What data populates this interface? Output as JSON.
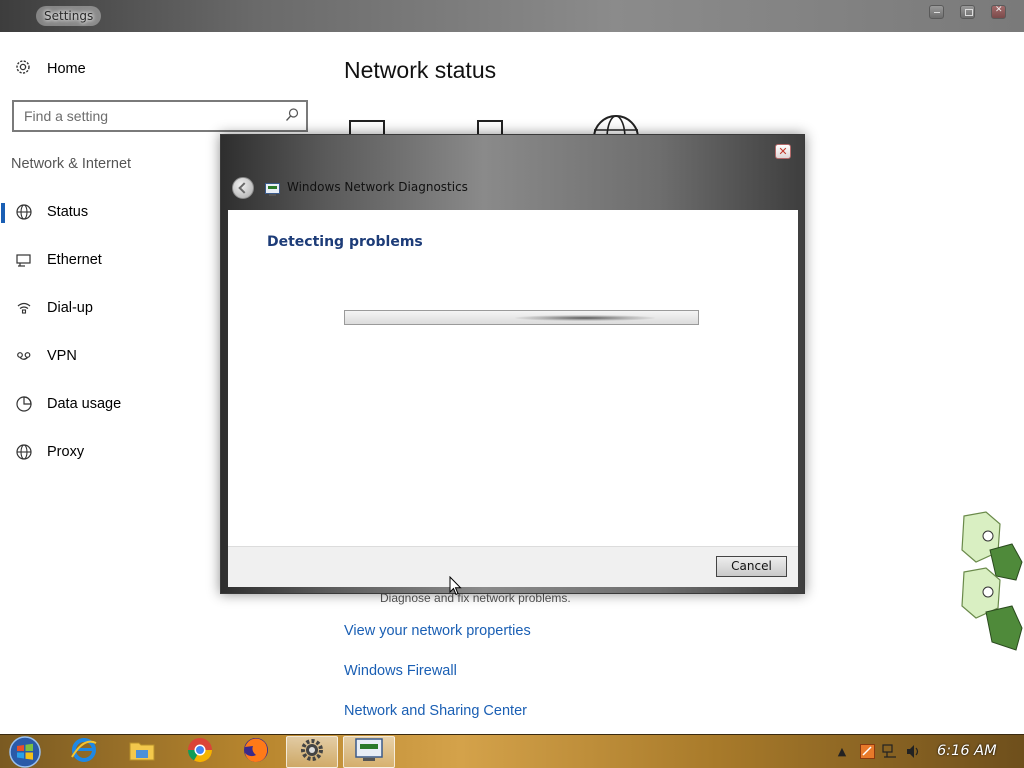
{
  "window": {
    "title": "Settings"
  },
  "sidebar": {
    "home_label": "Home",
    "search_placeholder": "Find a setting",
    "section_title": "Network & Internet",
    "items": [
      {
        "label": "Status",
        "icon": "globe-icon",
        "selected": true
      },
      {
        "label": "Ethernet",
        "icon": "ethernet-icon",
        "selected": false
      },
      {
        "label": "Dial-up",
        "icon": "dialup-icon",
        "selected": false
      },
      {
        "label": "VPN",
        "icon": "vpn-icon",
        "selected": false
      },
      {
        "label": "Data usage",
        "icon": "data-usage-icon",
        "selected": false
      },
      {
        "label": "Proxy",
        "icon": "proxy-globe-icon",
        "selected": false
      }
    ]
  },
  "main": {
    "title": "Network status",
    "troubleshooter_description": "Diagnose and fix network problems.",
    "links": [
      "View your network properties",
      "Windows Firewall",
      "Network and Sharing Center"
    ]
  },
  "dialog": {
    "title": "Windows Network Diagnostics",
    "heading": "Detecting problems",
    "cancel_label": "Cancel",
    "progress": "indeterminate",
    "accent_heading_color": "#1d3c78"
  },
  "taskbar": {
    "apps": [
      "internet-explorer-icon",
      "file-explorer-icon",
      "chrome-icon",
      "firefox-icon",
      "settings-gear-icon",
      "network-diagnostics-icon"
    ],
    "active_app": "network-diagnostics-icon",
    "tray_icons": [
      "show-hidden-icons-chevron",
      "app-tray-icon",
      "network-icon",
      "volume-icon"
    ],
    "clock": "6:16 AM"
  },
  "colors": {
    "accent": "#1a5fb4",
    "link": "#1a5fb4",
    "taskbar": "#b8862e"
  }
}
